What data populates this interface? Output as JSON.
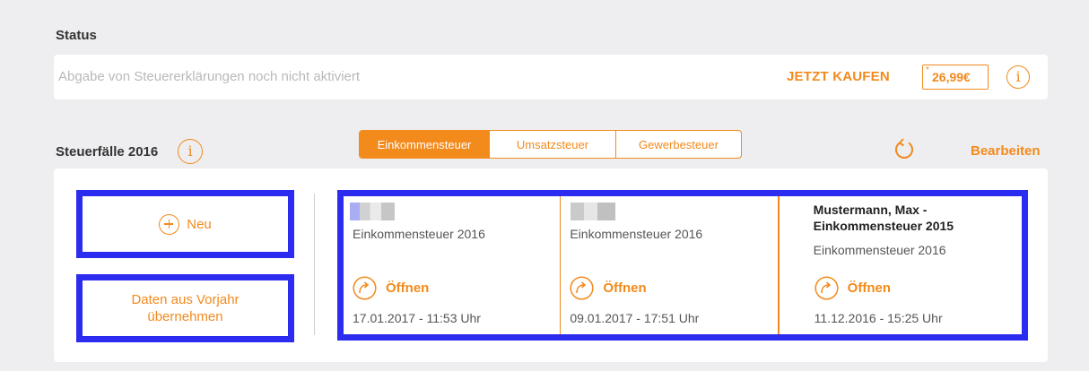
{
  "colors": {
    "accent": "#f28a1c",
    "highlight": "#2c2cf0",
    "background": "#eeeef0"
  },
  "status": {
    "title": "Status",
    "message": "Abgabe von Steuererklärungen noch nicht aktiviert",
    "buy_label": "JETZT KAUFEN",
    "price_marker": "*",
    "price": "26,99€",
    "info_icon": "i"
  },
  "cases": {
    "title": "Steuerfälle 2016",
    "info_icon": "i",
    "tabs": [
      {
        "label": "Einkommensteuer",
        "active": true
      },
      {
        "label": "Umsatzsteuer",
        "active": false
      },
      {
        "label": "Gewerbesteuer",
        "active": false
      }
    ],
    "refresh_icon": "refresh-icon",
    "edit_label": "Bearbeiten",
    "new_label": "Neu",
    "prev_year_label_1": "Daten aus Vorjahr",
    "prev_year_label_2": "übernehmen",
    "items": [
      {
        "type": "Einkommensteuer 2016",
        "open_label": "Öffnen",
        "date": "17.01.2017 - 11:53 Uhr"
      },
      {
        "type": "Einkommensteuer 2016",
        "open_label": "Öffnen",
        "date": "09.01.2017 - 17:51 Uhr"
      },
      {
        "title_line1": "Mustermann, Max -",
        "title_line2": "Einkommensteuer 2015",
        "type": "Einkommensteuer 2016",
        "open_label": "Öffnen",
        "date": "11.12.2016 - 15:25 Uhr"
      }
    ]
  }
}
